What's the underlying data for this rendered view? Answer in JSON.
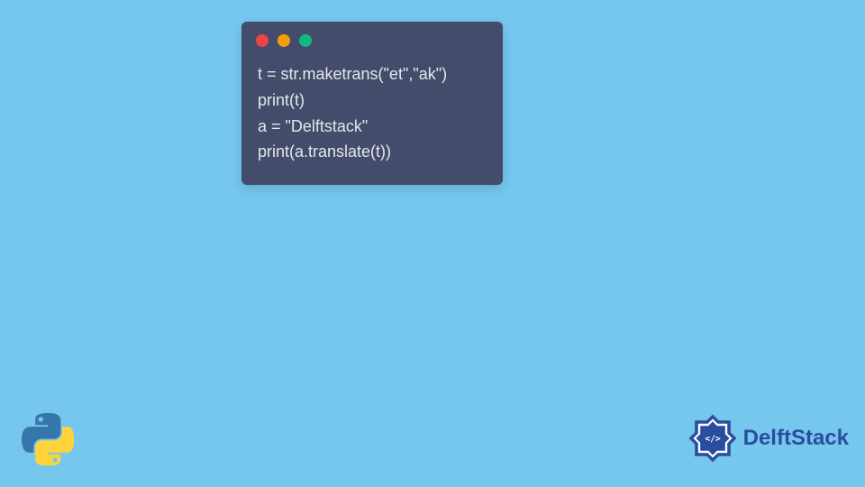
{
  "code": {
    "line1": "t = str.maketrans(\"et\",\"ak\")",
    "line2": "print(t)",
    "line3": "a = \"Delftstack\"",
    "line4": "print(a.translate(t))"
  },
  "brand": {
    "name": "DelftStack"
  },
  "colors": {
    "background": "#75c7ee",
    "codeWindow": "#434d6b",
    "codeText": "#e5e7eb",
    "brandText": "#2a4da0",
    "dotRed": "#ef4444",
    "dotYellow": "#f59e0b",
    "dotGreen": "#10b981"
  }
}
